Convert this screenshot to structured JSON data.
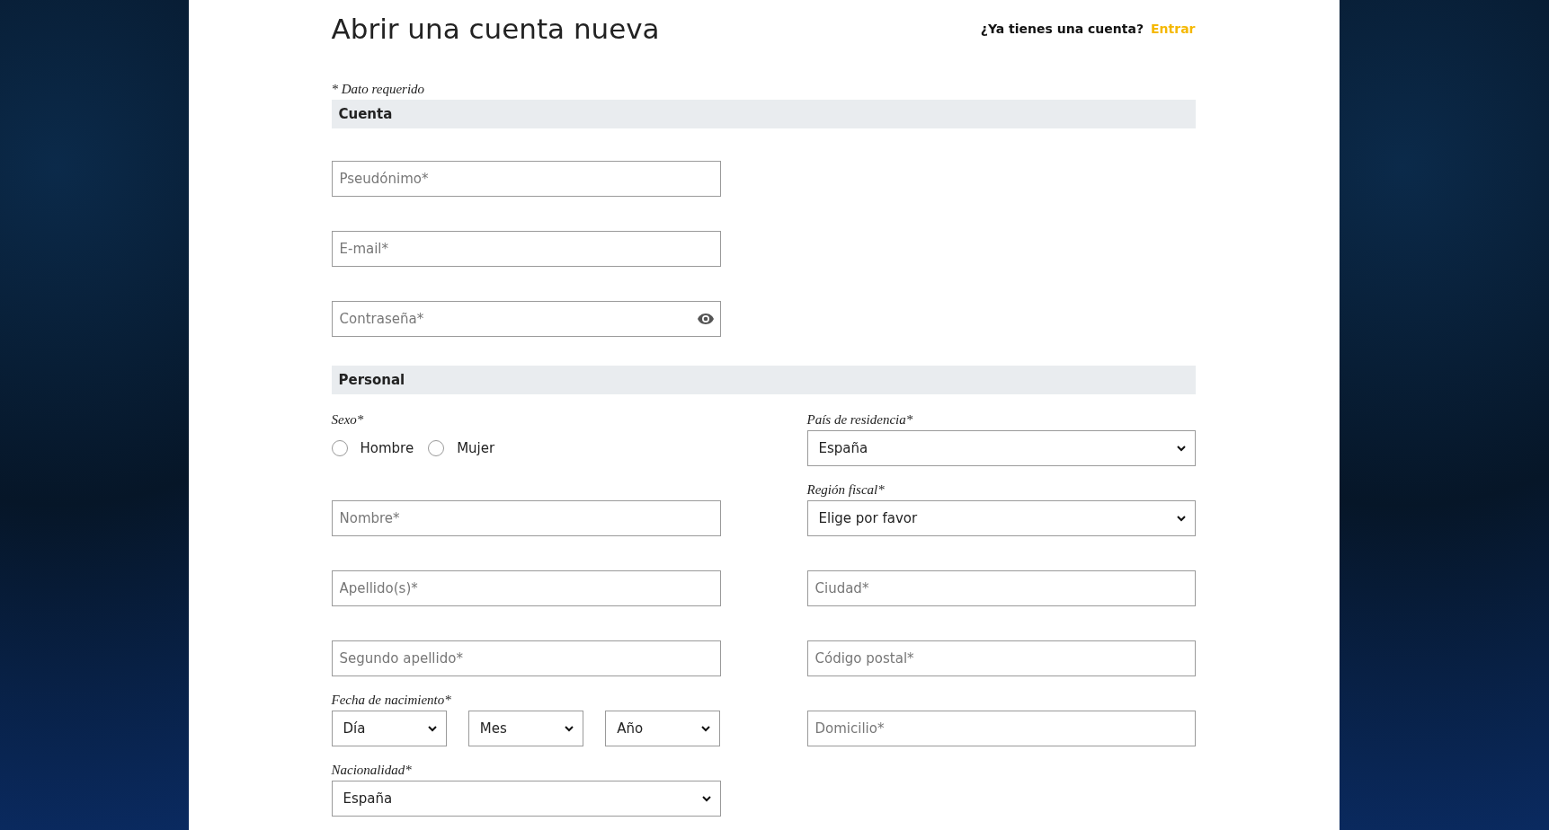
{
  "header": {
    "title": "Abrir una cuenta nueva",
    "login_prompt": "¿Ya tienes una cuenta?",
    "login_link": "Entrar"
  },
  "required_note": "* Dato requerido",
  "sections": [
    {
      "title": "Cuenta",
      "fields": [
        {
          "kind": "text",
          "placeholder": "Pseudónimo*"
        },
        {
          "kind": "text",
          "placeholder": "E-mail*"
        },
        {
          "kind": "password",
          "placeholder": "Contraseña*"
        }
      ]
    },
    {
      "title": "Personal",
      "fields": [
        {
          "kind": "radio",
          "label": "Sexo*",
          "options": [
            {
              "label": "Hombre",
              "selected": false
            },
            {
              "label": "Mujer",
              "selected": false
            }
          ]
        },
        {
          "kind": "select",
          "label": "País de residencia*",
          "value": "España"
        },
        {
          "kind": "text",
          "placeholder": "Nombre*"
        },
        {
          "kind": "select",
          "label": "Región fiscal*",
          "value": "Elige por favor"
        },
        {
          "kind": "text",
          "placeholder": "Apellido(s)*"
        },
        {
          "kind": "text",
          "placeholder": "Ciudad*"
        },
        {
          "kind": "text",
          "placeholder": "Segundo apellido*"
        },
        {
          "kind": "text",
          "placeholder": "Código postal*"
        },
        {
          "kind": "date",
          "label": "Fecha de nacimiento*",
          "parts": [
            "Día",
            "Mes",
            "Año"
          ]
        },
        {
          "kind": "text",
          "placeholder": "Domicilio*"
        },
        {
          "kind": "select",
          "label": "Nacionalidad*",
          "value": "España"
        }
      ]
    }
  ]
}
